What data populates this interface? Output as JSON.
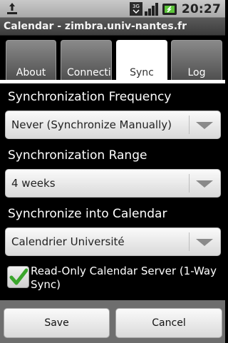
{
  "status_bar": {
    "time": "20:27",
    "icons": [
      "usb-icon",
      "3g-icon",
      "signal-icon",
      "battery-icon"
    ]
  },
  "window": {
    "title": "Calendar - zimbra.univ-nantes.fr"
  },
  "tabs": [
    {
      "label": "About"
    },
    {
      "label": "Connecti"
    },
    {
      "label": "Sync",
      "active": true
    },
    {
      "label": "Log"
    }
  ],
  "sync": {
    "frequency": {
      "label": "Synchronization Frequency",
      "value": "Never (Synchronize Manually)"
    },
    "range": {
      "label": "Synchronization Range",
      "value": "4 weeks"
    },
    "calendar": {
      "label": "Synchronize into Calendar",
      "value": "Calendrier Université"
    },
    "readonly": {
      "label": "Read-Only Calendar Server (1-Way Sync)",
      "checked": true
    }
  },
  "buttons": {
    "save": "Save",
    "cancel": "Cancel"
  },
  "colors": {
    "check_green": "#3aa52c",
    "tab_active_bg": "#ffffff",
    "bottom_bar": "#6e6e6e"
  }
}
